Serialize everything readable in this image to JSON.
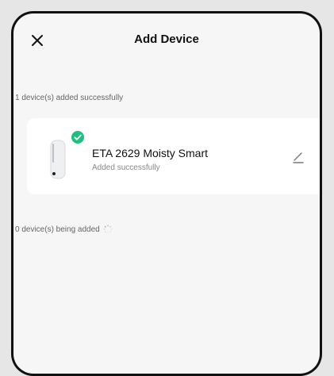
{
  "header": {
    "title": "Add Device",
    "close_icon": "close-icon"
  },
  "success_section": {
    "label": "1 device(s) added successfully"
  },
  "device": {
    "name": "ETA 2629 Moisty Smart",
    "status": "Added successfully",
    "status_icon": "check-circle-icon",
    "edit_icon": "edit-pencil-icon"
  },
  "adding_section": {
    "label": "0 device(s) being added",
    "icon": "loading-spinner-icon"
  },
  "colors": {
    "success_green": "#1fbf82",
    "card_bg": "#ffffff",
    "screen_bg": "#f6f6f6"
  }
}
